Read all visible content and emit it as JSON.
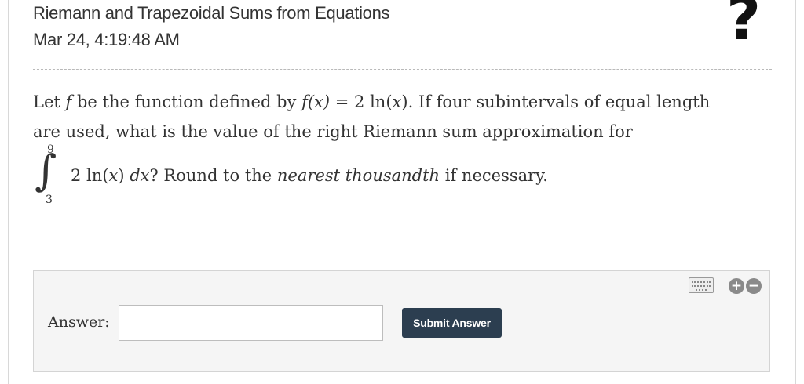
{
  "header": {
    "title": "Riemann and Trapezoidal Sums from Equations",
    "timestamp": "Mar 24, 4:19:48 AM",
    "help_symbol": "?"
  },
  "question": {
    "line1": {
      "p1": "Let ",
      "f_var": "f",
      "p2": " be the function defined by ",
      "fx": "f(x)",
      "p3": " = 2 ln(",
      "x_var": "x",
      "p4": "). If four subintervals of equal length"
    },
    "line2": "are used, what is the value of the right Riemann sum approximation for",
    "integral": {
      "sign": "∫",
      "upper": "9",
      "lower": "3",
      "integrand_prefix": "2 ln(",
      "integrand_var": "x",
      "integrand_mid": ") ",
      "differential": "dx",
      "p1": "? Round to the ",
      "emphasis": "nearest thousandth",
      "p2": " if necessary."
    }
  },
  "answer": {
    "label": "Answer:",
    "input_value": "",
    "submit_label": "Submit Answer",
    "zoom_in_symbol": "+",
    "zoom_out_symbol": "−"
  },
  "icons": {
    "help": "question-mark-icon",
    "keyboard": "keyboard-icon",
    "zoom_in": "zoom-in-icon",
    "zoom_out": "zoom-out-icon"
  },
  "colors": {
    "submit_button": "#2c3e50",
    "panel_bg": "#f5f5f5",
    "text": "#333333"
  }
}
